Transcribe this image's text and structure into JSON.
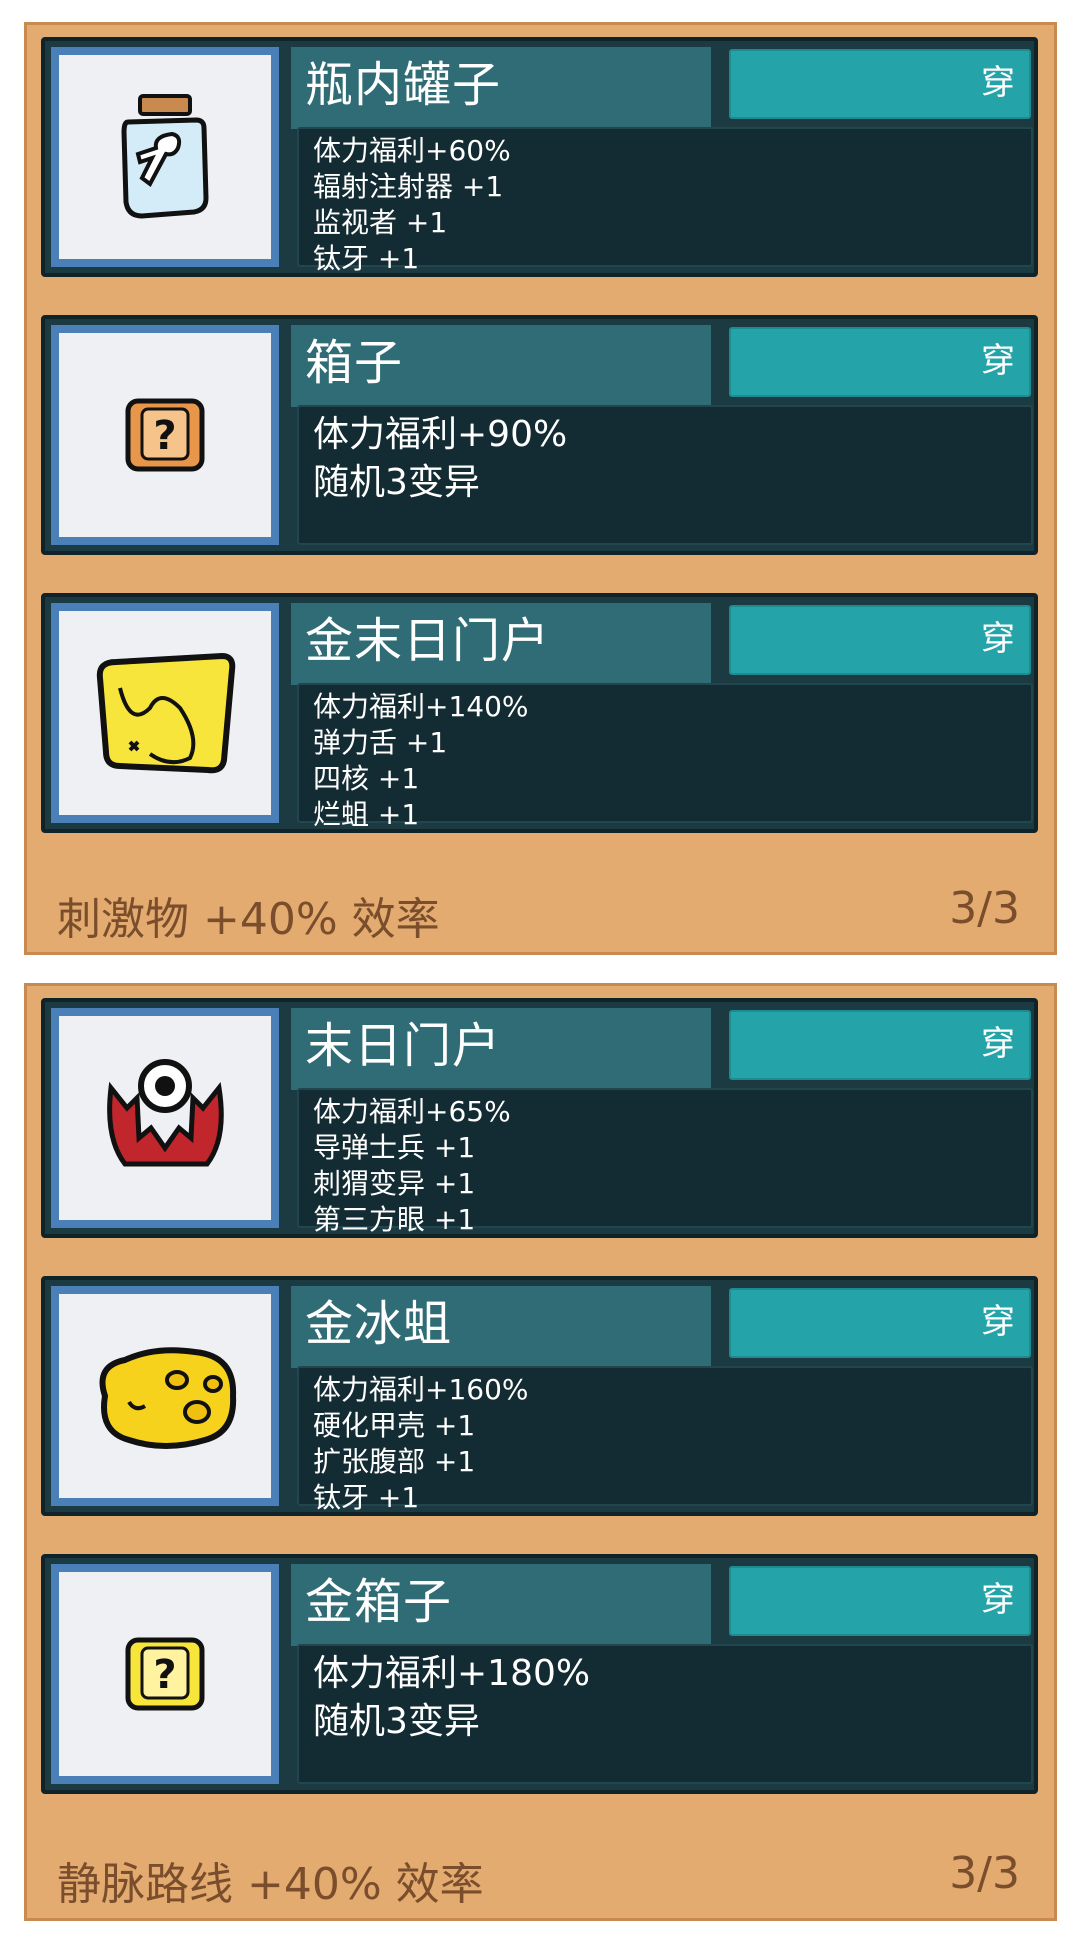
{
  "panels": [
    {
      "items": [
        {
          "title": "瓶内罐子",
          "button": "穿",
          "icon": "jar-icon",
          "lines": [
            "体力福利+60%",
            "辐射注射器 +1",
            "监视者 +1",
            "钛牙 +1"
          ]
        },
        {
          "title": "箱子",
          "button": "穿",
          "icon": "box-icon",
          "lines": [
            "体力福利+90%",
            "随机3变异"
          ]
        },
        {
          "title": "金末日门户",
          "button": "穿",
          "icon": "gold-portal-icon",
          "lines": [
            "体力福利+140%",
            "弹力舌 +1",
            "四核 +1",
            "烂蛆 +1"
          ]
        }
      ],
      "footer_text": "刺激物 +40% 效率",
      "footer_count": "3/3"
    },
    {
      "items": [
        {
          "title": "末日门户",
          "button": "穿",
          "icon": "portal-icon",
          "lines": [
            "体力福利+65%",
            "导弹士兵 +1",
            "刺猬变异 +1",
            "第三方眼 +1"
          ]
        },
        {
          "title": "金冰蛆",
          "button": "穿",
          "icon": "gold-ice-maggot-icon",
          "lines": [
            "体力福利+160%",
            "硬化甲壳 +1",
            "扩张腹部 +1",
            "钛牙 +1"
          ]
        },
        {
          "title": "金箱子",
          "button": "穿",
          "icon": "gold-box-icon",
          "lines": [
            "体力福利+180%",
            "随机3变异"
          ]
        }
      ],
      "footer_text": "静脉路线 +40% 效率",
      "footer_count": "3/3"
    }
  ]
}
